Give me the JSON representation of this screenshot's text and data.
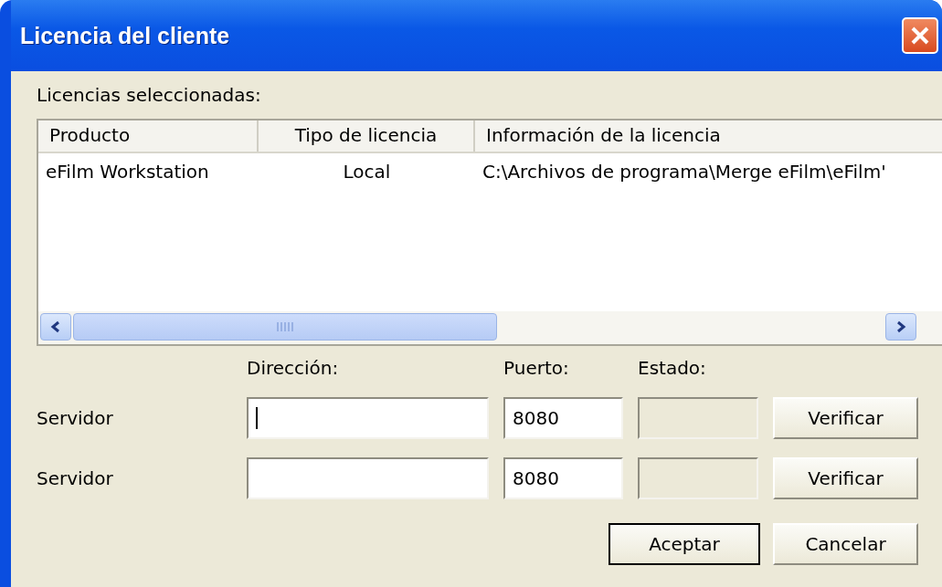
{
  "window": {
    "title": "Licencia del cliente"
  },
  "list": {
    "label": "Licencias seleccionadas:",
    "columns": [
      {
        "label": "Producto"
      },
      {
        "label": "Tipo de licencia"
      },
      {
        "label": "Información de la licencia"
      }
    ],
    "rows": [
      {
        "cells": [
          "eFilm Workstation",
          "Local",
          "C:\\Archivos de programa\\Merge eFilm\\eFilm'"
        ]
      }
    ]
  },
  "form": {
    "headers": [
      "Dirección:",
      "Puerto:",
      "Estado:"
    ],
    "servers": [
      {
        "label": "Servidor",
        "port": "8080",
        "focused": true,
        "button": "Verificar"
      },
      {
        "label": "Servidor",
        "port": "8080",
        "focused": false,
        "button": "Verificar"
      }
    ]
  },
  "buttons": [
    {
      "label": "Aceptar",
      "default": true
    },
    {
      "label": "Cancelar",
      "default": false
    }
  ]
}
